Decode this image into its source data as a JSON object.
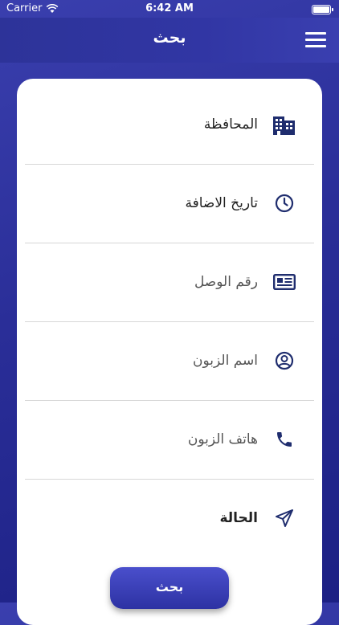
{
  "status_bar": {
    "carrier": "Carrier",
    "time": "6:42 AM"
  },
  "header": {
    "title": "بحث",
    "menu_icon": "hamburger-menu-icon"
  },
  "fields": [
    {
      "label": "المحافظة",
      "icon": "buildings-icon"
    },
    {
      "label": "تاريخ الاضافة",
      "icon": "clock-icon"
    },
    {
      "label": "رقم الوصل",
      "icon": "receipt-icon"
    },
    {
      "label": "اسم الزبون",
      "icon": "user-circle-icon"
    },
    {
      "label": "هاتف الزبون",
      "icon": "phone-icon"
    },
    {
      "label": "الحالة",
      "icon": "paper-plane-icon"
    }
  ],
  "search_button": {
    "label": "بحث"
  },
  "colors": {
    "primary": "#2d3399",
    "icon": "#1f2d6e",
    "card": "#ffffff"
  }
}
